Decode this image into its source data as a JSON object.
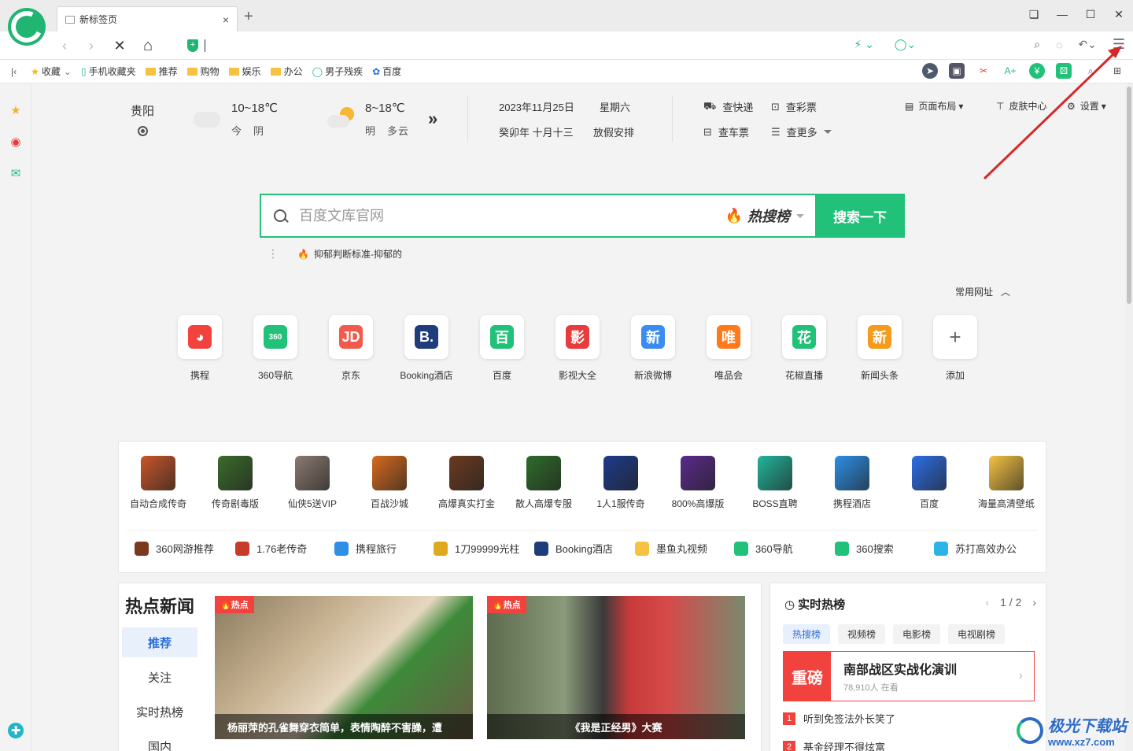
{
  "browser": {
    "tab_title": "新标签页",
    "tab_close": "×",
    "new_tab": "+",
    "window_controls": [
      "❏",
      "—",
      "☐",
      "✕"
    ]
  },
  "navbar": {
    "back": "‹",
    "forward": "›",
    "stop": "✕",
    "home": "⌂",
    "address_value": "",
    "shield": "+"
  },
  "bookmarks": [
    {
      "label": "收藏",
      "icon": "star-icon"
    },
    {
      "label": "手机收藏夹",
      "icon": "phone-icon"
    },
    {
      "label": "推荐",
      "icon": "folder-icon"
    },
    {
      "label": "购物",
      "icon": "folder-icon"
    },
    {
      "label": "娱乐",
      "icon": "folder-icon"
    },
    {
      "label": "办公",
      "icon": "folder-icon"
    },
    {
      "label": "男子残疾",
      "icon": "360-search-icon"
    },
    {
      "label": "百度",
      "icon": "baidu-icon"
    }
  ],
  "weather": {
    "city": "贵阳",
    "today_temp": "10~18℃",
    "today_label": "今　阴",
    "tomorrow_temp": "8~18℃",
    "tomorrow_label": "明　多云",
    "more": "»"
  },
  "calendar": {
    "date": "2023年11月25日",
    "weekday": "星期六",
    "lunar": "癸卯年 十月十三",
    "holiday": "放假安排"
  },
  "tools": {
    "express": "查快递",
    "lottery": "查彩票",
    "train": "查车票",
    "more": "查更多"
  },
  "top_right": {
    "layout": "页面布局",
    "skin": "皮肤中心",
    "settings": "设置"
  },
  "search": {
    "placeholder": "百度文库官网",
    "hot_rank": "热搜榜",
    "button": "搜索一下",
    "hint": "抑郁判断标准-抑郁的"
  },
  "speed_dial": {
    "header": "常用网址",
    "items": [
      {
        "label": "携程",
        "glyph": "◕",
        "color": "#f2423d"
      },
      {
        "label": "360导航",
        "glyph": "360",
        "color": "#21c17a"
      },
      {
        "label": "京东",
        "glyph": "JD",
        "color": "#f25b4b"
      },
      {
        "label": "Booking酒店",
        "glyph": "B.",
        "color": "#1f3d7a"
      },
      {
        "label": "百度",
        "glyph": "百",
        "color": "#21c17a"
      },
      {
        "label": "影视大全",
        "glyph": "影",
        "color": "#e83b3b"
      },
      {
        "label": "新浪微博",
        "glyph": "新",
        "color": "#3b8cf2"
      },
      {
        "label": "唯品会",
        "glyph": "唯",
        "color": "#ff7a1a"
      },
      {
        "label": "花椒直播",
        "glyph": "花",
        "color": "#21c17a"
      },
      {
        "label": "新闻头条",
        "glyph": "新",
        "color": "#f59a1b"
      },
      {
        "label": "添加",
        "glyph": "+",
        "color": "#ffffff"
      }
    ]
  },
  "games": [
    {
      "label": "自动合成传奇",
      "color": "#c8562a"
    },
    {
      "label": "传奇剧毒版",
      "color": "#3b6b2a"
    },
    {
      "label": "仙侠5送VIP",
      "color": "#8a7a70"
    },
    {
      "label": "百战沙城",
      "color": "#d66b1e"
    },
    {
      "label": "高爆真实打金",
      "color": "#6b3a20"
    },
    {
      "label": "散人高爆专服",
      "color": "#2e6b2a"
    },
    {
      "label": "1人1服传奇",
      "color": "#1e3a8a"
    },
    {
      "label": "800%高爆版",
      "color": "#5a2a8a"
    },
    {
      "label": "BOSS直聘",
      "color": "#21b59a"
    },
    {
      "label": "携程酒店",
      "color": "#2d8fe6"
    },
    {
      "label": "百度",
      "color": "#2d6fe6"
    },
    {
      "label": "海量高清壁纸",
      "color": "#f5c242"
    }
  ],
  "game_links": [
    {
      "label": "360网游推荐",
      "color": "#7a3a1e"
    },
    {
      "label": "1.76老传奇",
      "color": "#c83a2a"
    },
    {
      "label": "携程旅行",
      "color": "#2d8fe6"
    },
    {
      "label": "1刀99999光柱",
      "color": "#e0a81e"
    },
    {
      "label": "Booking酒店",
      "color": "#1f3d7a"
    },
    {
      "label": "墨鱼丸视频",
      "color": "#f5c242"
    },
    {
      "label": "360导航",
      "color": "#21c17a"
    },
    {
      "label": "360搜索",
      "color": "#21c17a"
    },
    {
      "label": "苏打高效办公",
      "color": "#2db4e6"
    }
  ],
  "news": {
    "title": "热点新闻",
    "nav": [
      "推荐",
      "关注",
      "实时热榜",
      "国内"
    ],
    "cards": [
      {
        "tag": "热点",
        "caption": "杨丽萍的孔雀舞穿衣简单，表情陶醉不害臊，遭"
      },
      {
        "tag": "热点",
        "caption": "《我是正经男》大赛"
      }
    ]
  },
  "hot_list": {
    "title": "实时热榜",
    "page": "1 / 2",
    "tabs": [
      "热搜榜",
      "视频榜",
      "电影榜",
      "电视剧榜"
    ],
    "top": {
      "badge": "重磅",
      "title": "南部战区实战化演训",
      "sub": "78,910人 在看"
    },
    "items": [
      {
        "num": "1",
        "text": "听到免签法外长笑了"
      },
      {
        "num": "2",
        "text": "基金经理不得炫富"
      }
    ]
  },
  "watermark": {
    "text": "极光下载站",
    "url": "www.xz7.com"
  },
  "colors": {
    "accent": "#21c17a",
    "hot": "#f2423d",
    "link_blue": "#2d6fd6",
    "annotation": "#d62828"
  }
}
